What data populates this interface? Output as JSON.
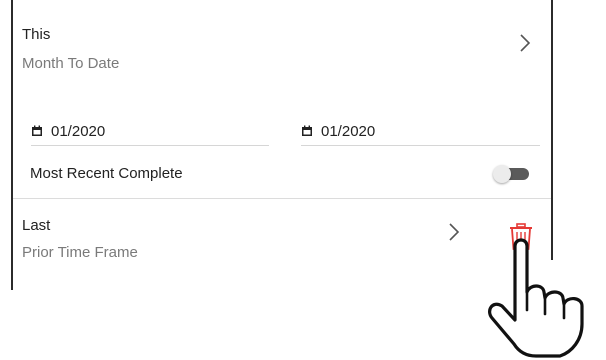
{
  "timeframe_this": {
    "title": "This",
    "subtitle": "Month To Date"
  },
  "date_range": {
    "start": "01/2020",
    "end": "01/2020"
  },
  "most_recent": {
    "label": "Most Recent Complete",
    "enabled": true
  },
  "timeframe_last": {
    "title": "Last",
    "subtitle": "Prior Time Frame"
  },
  "icons": {
    "chevron": "chevron-right-icon",
    "calendar": "calendar-icon",
    "trash": "trash-icon",
    "pointer": "hand-pointer-icon"
  },
  "colors": {
    "trash": "#e53935",
    "toggle_track": "#5a5a5a",
    "subtitle": "#7a7a7a"
  }
}
